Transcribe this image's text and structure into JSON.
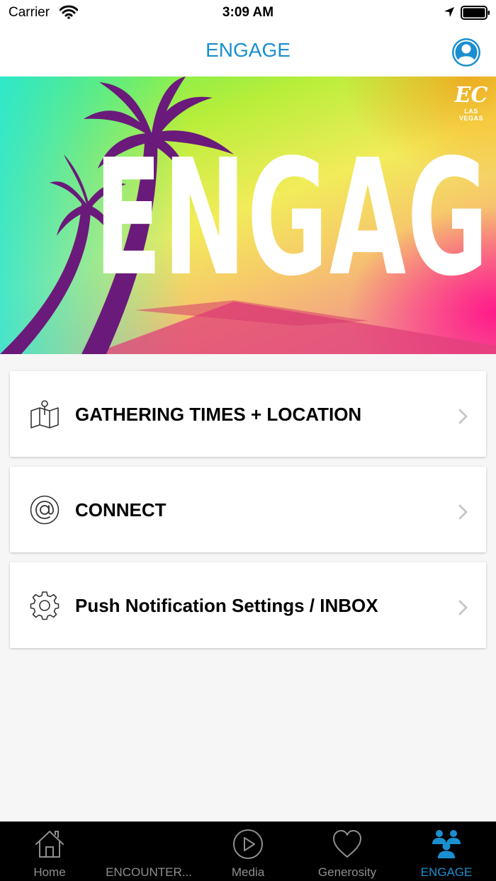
{
  "status_bar": {
    "carrier": "Carrier",
    "time": "3:09 AM"
  },
  "nav": {
    "title": "ENGAGE"
  },
  "hero": {
    "word": "ENGAGE",
    "logo_mark": "EC",
    "logo_text": "LAS VEGAS"
  },
  "menu": {
    "items": [
      {
        "label": "GATHERING TIMES + LOCATION",
        "icon": "map-pin-icon"
      },
      {
        "label": "CONNECT",
        "icon": "at-sign-icon"
      },
      {
        "label": "Push Notification Settings / INBOX",
        "icon": "gear-icon"
      }
    ]
  },
  "tabs": {
    "items": [
      {
        "label": "Home",
        "icon": "home-icon"
      },
      {
        "label": "ENCOUNTER...",
        "icon": ""
      },
      {
        "label": "Media",
        "icon": "play-icon"
      },
      {
        "label": "Generosity",
        "icon": "heart-icon"
      },
      {
        "label": "ENGAGE",
        "icon": "people-icon",
        "active": true
      }
    ]
  },
  "colors": {
    "accent": "#1a8fd0",
    "tab_bar": "#000000",
    "tab_inactive": "#8e8e8e",
    "background": "#f6f6f6"
  }
}
